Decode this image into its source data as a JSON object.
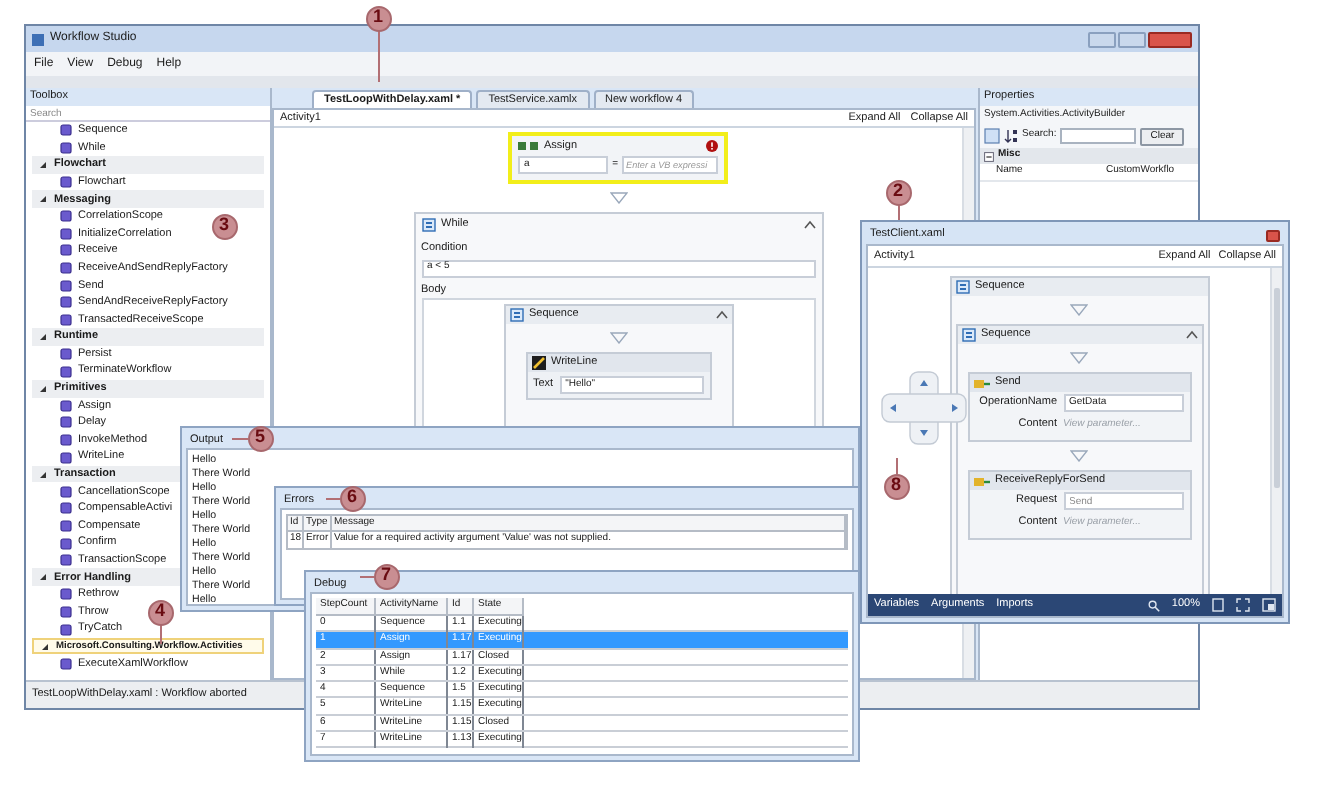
{
  "main_window": {
    "title": "Workflow Studio",
    "menu": [
      "File",
      "View",
      "Debug",
      "Help"
    ],
    "toolbox": {
      "title": "Toolbox",
      "placeholder": "Search",
      "top_items": [
        "Sequence",
        "While"
      ],
      "groups": [
        {
          "name": "Flowchart",
          "expanded": true,
          "highlighted": false,
          "items": [
            "Flowchart"
          ]
        },
        {
          "name": "Messaging",
          "expanded": true,
          "highlighted": false,
          "items": [
            "CorrelationScope",
            "InitializeCorrelation",
            "Receive",
            "ReceiveAndSendReplyFactory",
            "Send",
            "SendAndReceiveReplyFactory",
            "TransactedReceiveScope"
          ]
        },
        {
          "name": "Runtime",
          "expanded": true,
          "highlighted": false,
          "items": [
            "Persist",
            "TerminateWorkflow"
          ]
        },
        {
          "name": "Primitives",
          "expanded": true,
          "highlighted": false,
          "items": [
            "Assign",
            "Delay",
            "InvokeMethod",
            "WriteLine"
          ]
        },
        {
          "name": "Transaction",
          "expanded": true,
          "highlighted": false,
          "items": [
            "CancellationScope",
            "CompensableActivi",
            "Compensate",
            "Confirm",
            "TransactionScope"
          ]
        },
        {
          "name": "Error Handling",
          "expanded": true,
          "highlighted": false,
          "items": [
            "Rethrow",
            "Throw",
            "TryCatch"
          ]
        },
        {
          "name": "Microsoft.Consulting.Workflow.Activities",
          "expanded": true,
          "highlighted": true,
          "items": [
            "ExecuteXamlWorkflow"
          ]
        }
      ]
    },
    "tabs": [
      {
        "label": "TestLoopWithDelay.xaml *",
        "selected": true
      },
      {
        "label": "TestService.xamlx",
        "selected": false
      },
      {
        "label": "New workflow 4",
        "selected": false
      }
    ],
    "designer": {
      "breadcrumb": "Activity1",
      "expand_all": "Expand All",
      "collapse_all": "Collapse All",
      "assign": {
        "title": "Assign",
        "has_error": true,
        "to": "a",
        "operator": "=",
        "placeholder": "Enter a VB expressi"
      },
      "while": {
        "title": "While",
        "condition_label": "Condition",
        "condition": "a < 5",
        "body_label": "Body",
        "sequence": {
          "title": "Sequence",
          "writeline": {
            "title": "WriteLine",
            "text_label": "Text",
            "text": "\"Hello\""
          }
        }
      }
    },
    "properties": {
      "title": "Properties",
      "type": "System.Activities.ActivityBuilder",
      "search_label": "Search:",
      "clear": "Clear",
      "category": "Misc",
      "rows": [
        {
          "name": "Name",
          "value": "CustomWorkflo"
        }
      ]
    },
    "status": "TestLoopWithDelay.xaml : Workflow aborted"
  },
  "test_client": {
    "title": "TestClient.xaml",
    "breadcrumb": "Activity1",
    "expand_all": "Expand All",
    "collapse_all": "Collapse All",
    "outer_sequence": "Sequence",
    "inner_sequence": "Sequence",
    "activities": [
      {
        "title": "Send",
        "fields": [
          {
            "label": "OperationName",
            "kind": "input",
            "value": "GetData"
          },
          {
            "label": "Content",
            "kind": "link",
            "value": "View parameter..."
          }
        ]
      },
      {
        "title": "ReceiveReplyForSend",
        "fields": [
          {
            "label": "Request",
            "kind": "input",
            "placeholder": "Send"
          },
          {
            "label": "Content",
            "kind": "link",
            "value": "View parameter..."
          }
        ]
      }
    ],
    "footer_tabs": [
      "Variables",
      "Arguments",
      "Imports"
    ],
    "zoom": "100%"
  },
  "output": {
    "title": "Output",
    "lines": [
      "Hello",
      "There World",
      "Hello",
      "There World",
      "Hello",
      "There World",
      "Hello",
      "There World",
      "Hello",
      "There World",
      "Hello"
    ]
  },
  "errors": {
    "title": "Errors",
    "columns": [
      "Id",
      "Type",
      "Message"
    ],
    "rows": [
      [
        "18",
        "Error",
        "Value for a required activity argument 'Value' was not supplied."
      ]
    ]
  },
  "debug": {
    "title": "Debug",
    "columns": [
      "StepCount",
      "ActivityName",
      "Id",
      "State"
    ],
    "rows": [
      {
        "cells": [
          "0",
          "Sequence",
          "1.1",
          "Executing"
        ],
        "selected": false
      },
      {
        "cells": [
          "1",
          "Assign",
          "1.17",
          "Executing"
        ],
        "selected": true
      },
      {
        "cells": [
          "2",
          "Assign",
          "1.17",
          "Closed"
        ],
        "selected": false
      },
      {
        "cells": [
          "3",
          "While",
          "1.2",
          "Executing"
        ],
        "selected": false
      },
      {
        "cells": [
          "4",
          "Sequence",
          "1.5",
          "Executing"
        ],
        "selected": false
      },
      {
        "cells": [
          "5",
          "WriteLine",
          "1.15",
          "Executing"
        ],
        "selected": false
      },
      {
        "cells": [
          "6",
          "WriteLine",
          "1.15",
          "Closed"
        ],
        "selected": false
      },
      {
        "cells": [
          "7",
          "WriteLine",
          "1.13",
          "Executing"
        ],
        "selected": false
      }
    ]
  },
  "callouts": [
    "1",
    "2",
    "3",
    "4",
    "5",
    "6",
    "7",
    "8"
  ]
}
